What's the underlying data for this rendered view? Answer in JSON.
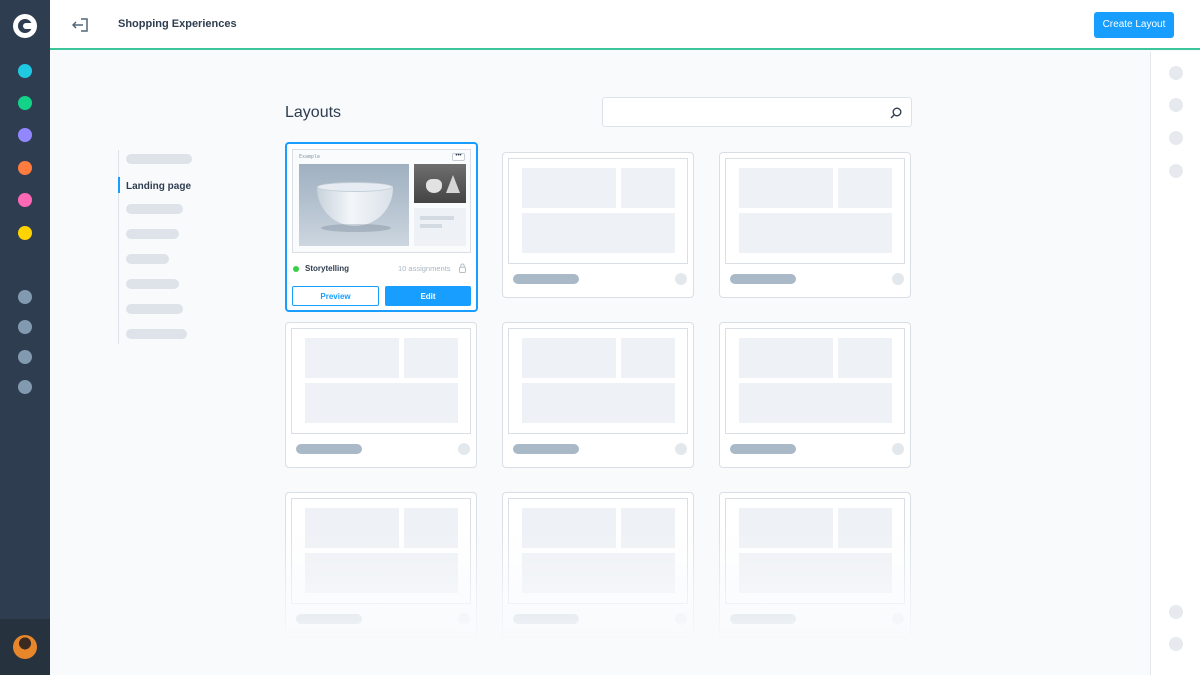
{
  "header": {
    "module_title": "Shopping Experiences",
    "create_button": "Create Layout"
  },
  "sidebar": {
    "module_colors": [
      "#1fc9e1",
      "#13d389",
      "#9387ff",
      "#ff7b3e",
      "#ff68b4",
      "#ffd300"
    ],
    "neutral_color": "#829aaf"
  },
  "tree": {
    "active_item": "Landing page"
  },
  "main": {
    "title": "Layouts",
    "search": {
      "placeholder": "",
      "value": ""
    }
  },
  "featured_card": {
    "preview_label": "Example",
    "menu_label": "•••",
    "name": "Storytelling",
    "assignments": "10 assignments",
    "status_color": "#37d046",
    "preview_button": "Preview",
    "edit_button": "Edit"
  },
  "colors": {
    "accent": "#189eff",
    "topbar_border": "#3cc49b",
    "sidebar_bg": "#2e3d4f"
  }
}
